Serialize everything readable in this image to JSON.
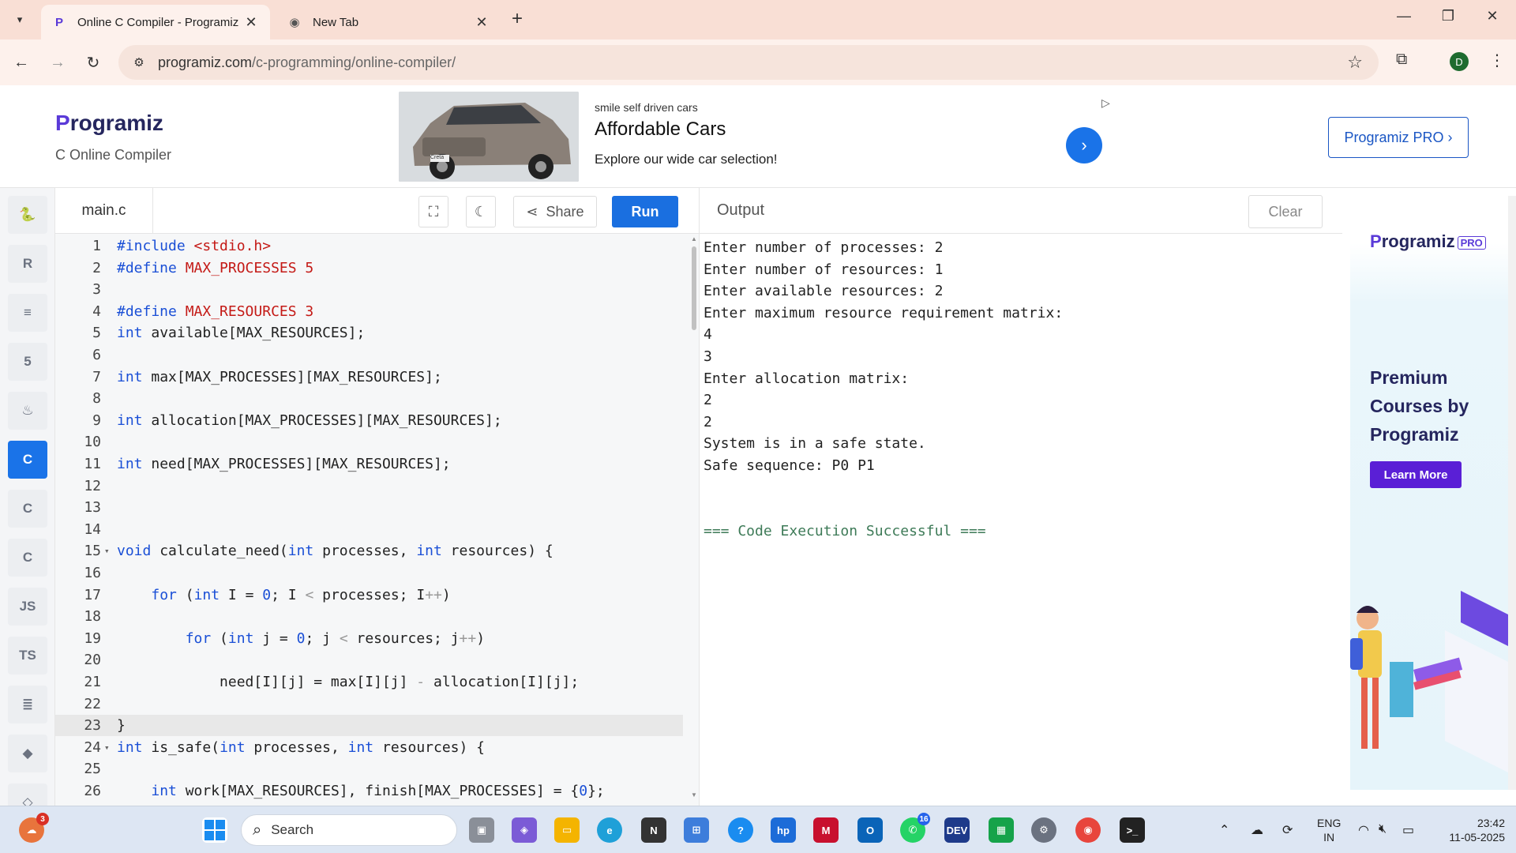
{
  "browser": {
    "tabs": [
      {
        "title": "Online C Compiler - Programiz",
        "active": true
      },
      {
        "title": "New Tab",
        "active": false
      }
    ],
    "url_host": "programiz.com",
    "url_path": "/c-programming/online-compiler/",
    "profile_initial": "D"
  },
  "header": {
    "logo_text": "rogramiz",
    "logo_p": "P",
    "subtitle": "C Online Compiler",
    "pro_button": "Programiz PRO ›"
  },
  "ad": {
    "source": "smile self driven cars",
    "title": "Affordable Cars",
    "description": "Explore our wide car selection!",
    "car_badge": "Creta"
  },
  "sidebar": {
    "items": [
      {
        "name": "python",
        "icon": "python-icon",
        "glyph": "🐍"
      },
      {
        "name": "r",
        "icon": "r-icon",
        "glyph": "R"
      },
      {
        "name": "sql",
        "icon": "database-icon",
        "glyph": "≡"
      },
      {
        "name": "html",
        "icon": "html5-icon",
        "glyph": "5"
      },
      {
        "name": "java",
        "icon": "java-icon",
        "glyph": "♨"
      },
      {
        "name": "c",
        "icon": "c-icon",
        "glyph": "C",
        "active": true
      },
      {
        "name": "cpp",
        "icon": "cpp-icon",
        "glyph": "C"
      },
      {
        "name": "csharp",
        "icon": "csharp-icon",
        "glyph": "C"
      },
      {
        "name": "js",
        "icon": "js-icon",
        "glyph": "JS"
      },
      {
        "name": "ts",
        "icon": "ts-icon",
        "glyph": "TS"
      },
      {
        "name": "go",
        "icon": "stack-icon",
        "glyph": "≣"
      },
      {
        "name": "swift",
        "icon": "swift-icon",
        "glyph": "◆"
      },
      {
        "name": "rust",
        "icon": "rust-icon",
        "glyph": "◇"
      }
    ]
  },
  "editor": {
    "filename": "main.c",
    "share_label": "Share",
    "run_label": "Run",
    "current_line": 23
  },
  "code_lines": [
    {
      "n": "1",
      "html": "<span class='pp'>#include</span> <span class='mc'>&lt;stdio.h&gt;</span>"
    },
    {
      "n": "2",
      "html": "<span class='pp'>#define</span> <span class='mc'>MAX_PROCESSES 5</span>"
    },
    {
      "n": "3",
      "html": ""
    },
    {
      "n": "4",
      "html": "<span class='pp'>#define</span> <span class='mc'>MAX_RESOURCES 3</span>"
    },
    {
      "n": "5",
      "html": "<span class='kw'>int</span> available[MAX_RESOURCES];"
    },
    {
      "n": "6",
      "html": ""
    },
    {
      "n": "7",
      "html": "<span class='kw'>int</span> max[MAX_PROCESSES][MAX_RESOURCES];"
    },
    {
      "n": "8",
      "html": ""
    },
    {
      "n": "9",
      "html": "<span class='kw'>int</span> allocation[MAX_PROCESSES][MAX_RESOURCES];"
    },
    {
      "n": "10",
      "html": ""
    },
    {
      "n": "11",
      "html": "<span class='kw'>int</span> need[MAX_PROCESSES][MAX_RESOURCES];"
    },
    {
      "n": "12",
      "html": ""
    },
    {
      "n": "13",
      "html": ""
    },
    {
      "n": "14",
      "html": ""
    },
    {
      "n": "15",
      "fold": true,
      "html": "<span class='kw'>void</span> calculate_need(<span class='kw'>int</span> processes, <span class='kw'>int</span> resources) {"
    },
    {
      "n": "16",
      "html": ""
    },
    {
      "n": "17",
      "html": "    <span class='kw'>for</span> (<span class='kw'>int</span> I = <span class='num'>0</span>; I <span class='op'>&lt;</span> processes; I<span class='op'>++</span>)"
    },
    {
      "n": "18",
      "html": ""
    },
    {
      "n": "19",
      "html": "        <span class='kw'>for</span> (<span class='kw'>int</span> j = <span class='num'>0</span>; j <span class='op'>&lt;</span> resources; j<span class='op'>++</span>)"
    },
    {
      "n": "20",
      "html": ""
    },
    {
      "n": "21",
      "html": "            need[I][j] = max[I][j] <span class='op'>-</span> allocation[I][j];"
    },
    {
      "n": "22",
      "html": ""
    },
    {
      "n": "23",
      "html": "}"
    },
    {
      "n": "24",
      "fold": true,
      "html": "<span class='kw'>int</span> is_safe(<span class='kw'>int</span> processes, <span class='kw'>int</span> resources) {"
    },
    {
      "n": "25",
      "html": ""
    },
    {
      "n": "26",
      "html": "    <span class='kw'>int</span> work[MAX_RESOURCES], finish[MAX_PROCESSES] = {<span class='num'>0</span>};"
    }
  ],
  "output": {
    "title": "Output",
    "clear_label": "Clear",
    "lines": [
      "Enter number of processes: 2",
      "Enter number of resources: 1",
      "Enter available resources: 2",
      "Enter maximum resource requirement matrix:",
      "4",
      "3",
      "Enter allocation matrix:",
      "2",
      "2",
      "System is in a safe state.",
      "Safe sequence: P0 P1",
      "",
      "",
      "=== Code Execution Successful ==="
    ]
  },
  "right_ad": {
    "logo_text": "rogramiz",
    "logo_p": "P",
    "logo_badge": "PRO",
    "title": "Premium Courses by Programiz",
    "cta": "Learn More"
  },
  "taskbar": {
    "search_label": "Search",
    "notification_count": "3",
    "outlook_badge": "16",
    "language_top": "ENG",
    "language_bottom": "IN",
    "time": "23:42",
    "date": "11-05-2025"
  }
}
